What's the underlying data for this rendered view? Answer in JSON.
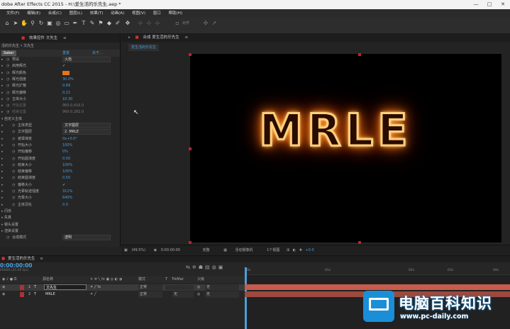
{
  "title": "dobe After Effects CC 2015 - H:\\爱生活的乐先生.aep *",
  "window_controls": [
    "—",
    "□",
    "✕"
  ],
  "menu": [
    "文件(F)",
    "编辑(E)",
    "合成(C)",
    "图层(L)",
    "效果(T)",
    "动画(A)",
    "视图(V)",
    "窗口",
    "帮助(H)"
  ],
  "toolbar": {
    "snap_label": "对齐"
  },
  "effects_panel": {
    "tab_title": "效果控件 文先生",
    "breadcrumb": "活的乐先生 • 文先生",
    "plugin_name": "Saber",
    "reset": "重置",
    "about": "关于...",
    "props": [
      {
        "label": "预设",
        "value": "火焰",
        "type": "dropdown"
      },
      {
        "label": "启用辉光",
        "value": "✓",
        "type": "check"
      },
      {
        "label": "辉光颜色",
        "value": "",
        "type": "color"
      },
      {
        "label": "辉光强度",
        "value": "30.0%",
        "type": "num"
      },
      {
        "label": "辉光扩散",
        "value": "0.89",
        "type": "num"
      },
      {
        "label": "辉光偏移",
        "value": "0.21",
        "type": "num"
      },
      {
        "label": "主体大小",
        "value": "10.30",
        "type": "num"
      },
      {
        "label": "开始位置",
        "value": "960.0,416.0",
        "type": "gray"
      },
      {
        "label": "结束位置",
        "value": "960.0,282.0",
        "type": "gray"
      }
    ],
    "custom_group": "自定义主体",
    "custom_props": [
      {
        "label": "主体类型",
        "value": "文字图层",
        "type": "dropdown"
      },
      {
        "label": "文字图层",
        "value": "2. MRLE",
        "type": "dropdown"
      },
      {
        "label": "遮罩演变",
        "value": "0x+0.0°",
        "type": "num"
      },
      {
        "label": "开始大小",
        "value": "100%",
        "type": "num"
      },
      {
        "label": "开始偏移",
        "value": "0%",
        "type": "num"
      },
      {
        "label": "开始圆滑度",
        "value": "0.50",
        "type": "num"
      },
      {
        "label": "结束大小",
        "value": "100%",
        "type": "num"
      },
      {
        "label": "结束偏移",
        "value": "100%",
        "type": "num"
      },
      {
        "label": "结束圆滑度",
        "value": "0.50",
        "type": "num"
      },
      {
        "label": "偏移大小",
        "value": "✓",
        "type": "check"
      },
      {
        "label": "光晕轨迹强度",
        "value": "311%",
        "type": "num"
      },
      {
        "label": "光晕大小",
        "value": "640%",
        "type": "num"
      },
      {
        "label": "主体羽化",
        "value": "0.0",
        "type": "num"
      }
    ],
    "bottom_groups": [
      "闪烁",
      "失真",
      "镜头设置",
      "渲染设置"
    ],
    "last_row": {
      "label": "合成模式",
      "value": "透明"
    }
  },
  "comp_panel": {
    "tab_title": "合成 爱生活的乐先生",
    "subtab": "爱生活的乐先生",
    "text": "MRLE",
    "footer": {
      "zoom": "(49.5%)",
      "time": "0:00:00:00",
      "resolution": "完整",
      "camera": "活动摄像机",
      "views": "1个视图",
      "exposure": "+0.0"
    }
  },
  "timeline": {
    "tab_title": "爱生活的乐先生",
    "timecode": "0:00:00:00",
    "fps": "00000 (25.00 fps)",
    "columns": {
      "name": "源名称",
      "mode": "模式",
      "trkmat": "TrkMat",
      "parent": "父级"
    },
    "layers": [
      {
        "num": "1",
        "name": "文先生",
        "mode": "正常",
        "trkmat": "",
        "parent": "无"
      },
      {
        "num": "2",
        "name": "MRLE",
        "mode": "正常",
        "trkmat": "无",
        "parent": "无"
      }
    ],
    "ruler": [
      "0s",
      "01s",
      "02s",
      "03s",
      "04s"
    ]
  },
  "watermark": {
    "title": "电脑百科知识",
    "url": "www.pc-daily.com"
  },
  "colors": {
    "glow": "#e8731c",
    "accent_blue": "#4a9fdd",
    "layer_bar": "#c65c4d",
    "watermark_blue": "#1a8fd8"
  }
}
